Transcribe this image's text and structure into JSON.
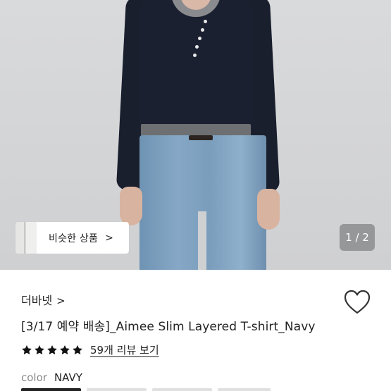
{
  "gallery": {
    "similar_label": "비슷한 상품",
    "similar_chevron": ">",
    "counter": "1 / 2"
  },
  "product": {
    "store": "더바넷",
    "store_chevron": ">",
    "title": "[3/17 예약 배송]_Aimee Slim Layered T-shirt_Navy",
    "rating": 5,
    "reviews_label": "59개 리뷰 보기",
    "color_label": "color",
    "color_value": "NAVY"
  },
  "icons": {
    "heart": "heart-outline-icon",
    "star": "star-filled-icon",
    "chevron": "chevron-right-icon"
  },
  "colors": {
    "text": "#222222",
    "muted": "#8a8a8a",
    "background": "#ffffff"
  }
}
